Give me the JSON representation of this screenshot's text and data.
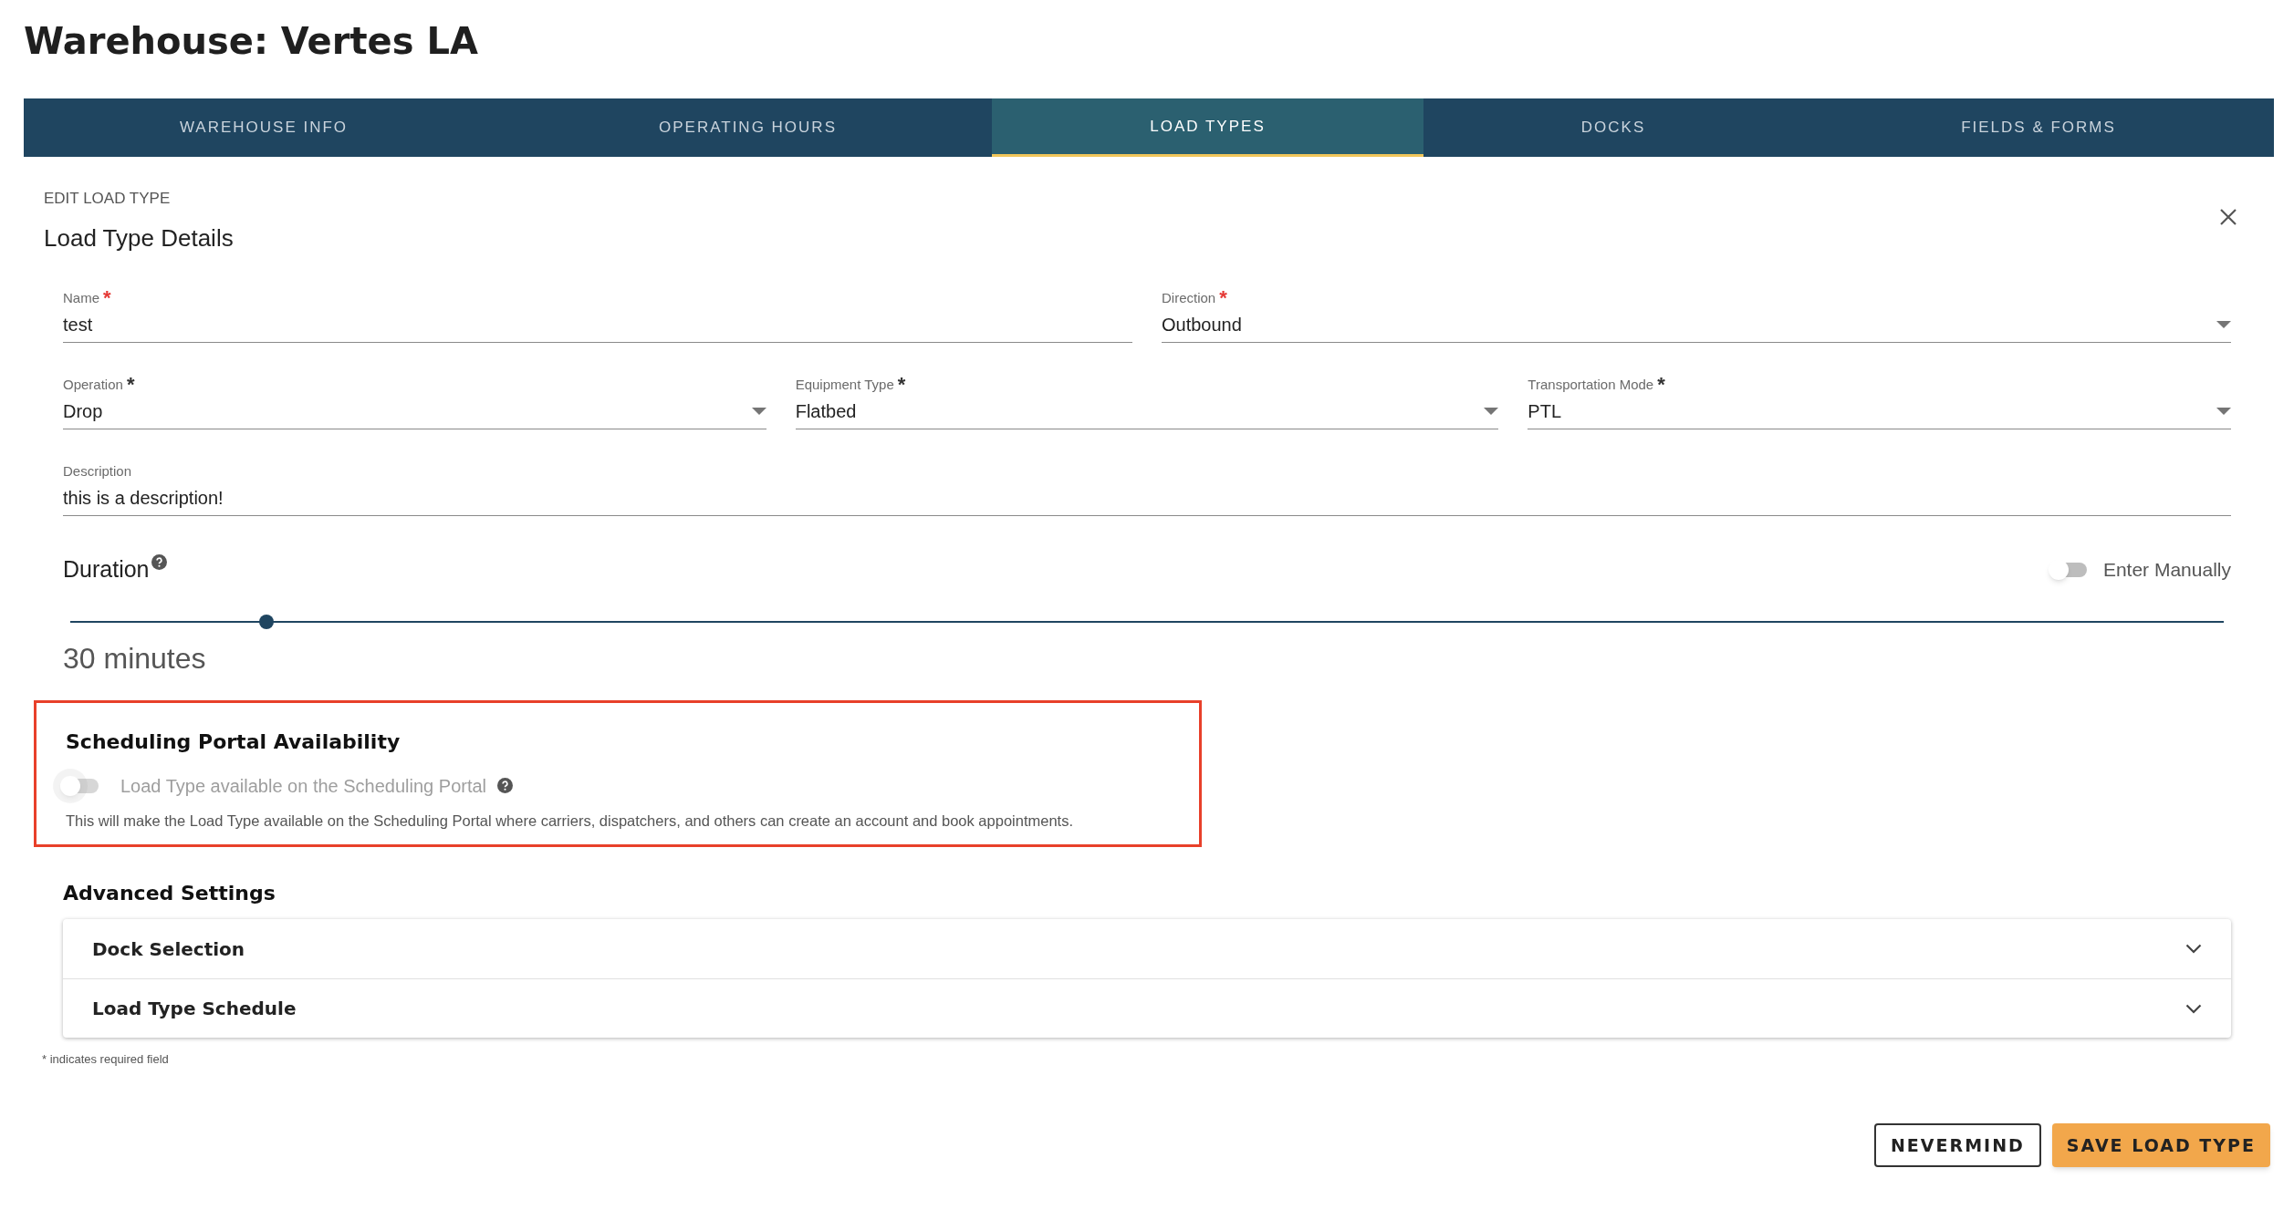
{
  "page_title": "Warehouse: Vertes LA",
  "tabs": [
    {
      "label": "WAREHOUSE INFO",
      "selected": false
    },
    {
      "label": "OPERATING HOURS",
      "selected": false
    },
    {
      "label": "LOAD TYPES",
      "selected": true
    },
    {
      "label": "DOCKS",
      "selected": false
    },
    {
      "label": "FIELDS & FORMS",
      "selected": false
    }
  ],
  "form": {
    "overline": "EDIT LOAD TYPE",
    "title": "Load Type Details",
    "rows": [
      [
        {
          "kind": "text",
          "label": "Name",
          "required_mark": "*",
          "color": "#e53935",
          "value": "test"
        },
        {
          "kind": "select",
          "label": "Direction",
          "required_mark": "*",
          "color": "#e53935",
          "value": "Outbound"
        }
      ],
      [
        {
          "kind": "select",
          "label": "Operation",
          "required_mark": "*",
          "color": "#333333",
          "value": "Drop"
        },
        {
          "kind": "select",
          "label": "Equipment Type",
          "required_mark": "*",
          "color": "#333333",
          "value": "Flatbed"
        },
        {
          "kind": "select",
          "label": "Transportation Mode",
          "required_mark": "*",
          "color": "#333333",
          "value": "PTL"
        }
      ],
      [
        {
          "kind": "text",
          "label": "Description",
          "value": "this is a description!"
        }
      ]
    ],
    "duration": {
      "label": "Duration",
      "manual_toggle": {
        "label": "Enter Manually",
        "on": false
      },
      "level": 0.091,
      "reading": "30 minutes"
    },
    "scheduling_portal": {
      "highlighted": true,
      "title": "Scheduling Portal Availability",
      "toggle": {
        "label": "Load Type available on the Scheduling Portal",
        "on": false,
        "disabled": true
      },
      "help": "This will make the Load Type available on the Scheduling Portal where carriers, dispatchers, and others can create an account and book appointments."
    },
    "advanced": {
      "title": "Advanced Settings",
      "sections": [
        {
          "label": "Dock Selection",
          "expanded": false
        },
        {
          "label": "Load Type Schedule",
          "expanded": false
        }
      ]
    },
    "footnote": "* indicates required field"
  },
  "buttons": [
    {
      "kind": "outline",
      "label": "NEVERMIND"
    },
    {
      "kind": "primary",
      "label": "SAVE LOAD TYPE"
    }
  ]
}
